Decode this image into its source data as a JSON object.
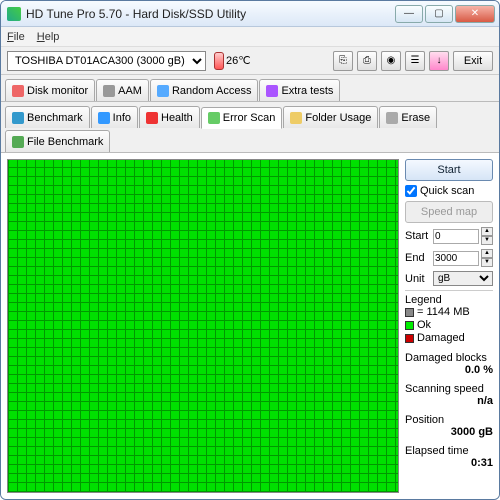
{
  "window": {
    "title": "HD Tune Pro 5.70 - Hard Disk/SSD Utility"
  },
  "menu": {
    "file": "File",
    "help": "Help"
  },
  "toolbar": {
    "drive": "TOSHIBA DT01ACA300 (3000 gB)",
    "temp": "26℃",
    "exit": "Exit"
  },
  "tabs": {
    "row1": [
      "Disk monitor",
      "AAM",
      "Random Access",
      "Extra tests"
    ],
    "row2": [
      "Benchmark",
      "Info",
      "Health",
      "Error Scan",
      "Folder Usage",
      "Erase",
      "File Benchmark"
    ],
    "active": "Error Scan"
  },
  "controls": {
    "start": "Start",
    "quickscan": "Quick scan",
    "speedmap": "Speed map",
    "start_label": "Start",
    "end_label": "End",
    "start_val": "0",
    "end_val": "3000",
    "unit_label": "Unit",
    "unit_val": "gB"
  },
  "legend": {
    "title": "Legend",
    "block": "= 1144 MB",
    "ok": "Ok",
    "damaged": "Damaged"
  },
  "stats": {
    "damaged_label": "Damaged blocks",
    "damaged_val": "0.0 %",
    "speed_label": "Scanning speed",
    "speed_val": "n/a",
    "pos_label": "Position",
    "pos_val": "3000 gB",
    "time_label": "Elapsed time",
    "time_val": "0:31"
  }
}
